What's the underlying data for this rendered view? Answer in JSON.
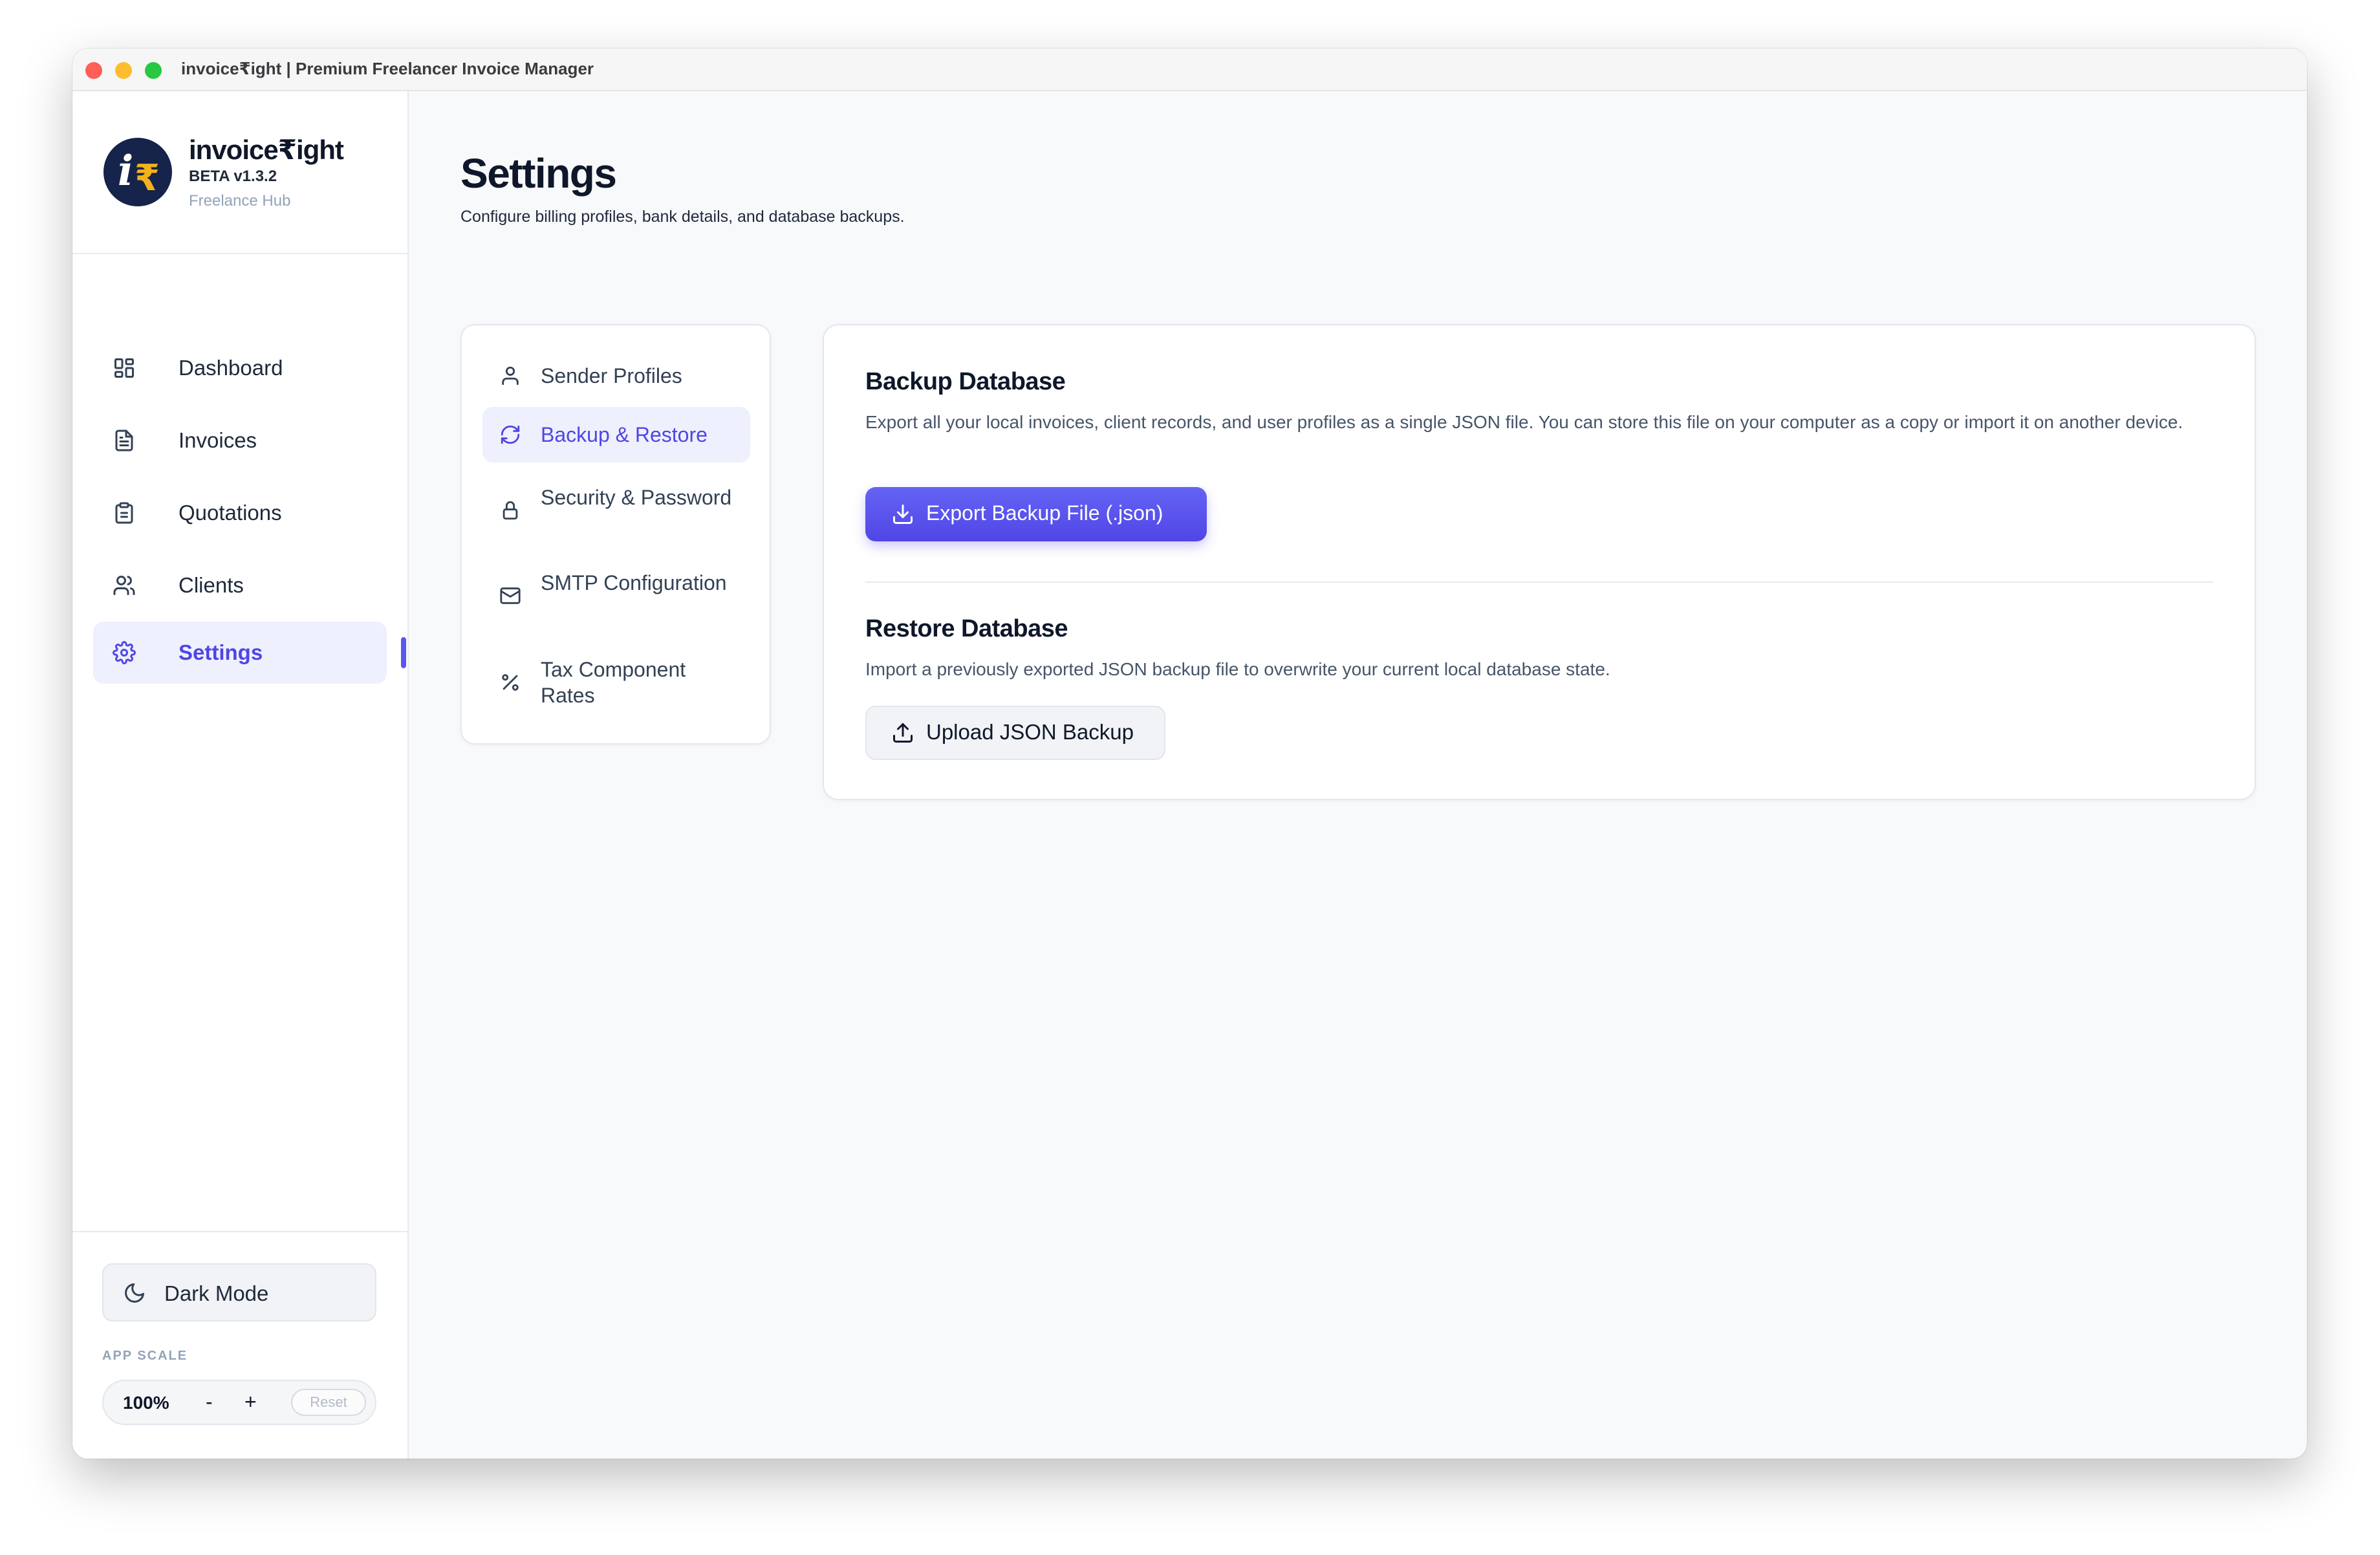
{
  "window": {
    "title": "invoice₹ight | Premium Freelancer Invoice Manager"
  },
  "brand": {
    "name": "invoice₹ight",
    "version": "BETA v1.3.2",
    "tagline": "Freelance Hub",
    "logo_letters": {
      "i": "i",
      "r": "₹"
    }
  },
  "sidebar": {
    "items": [
      {
        "label": "Dashboard",
        "icon": "dashboard-grid-icon"
      },
      {
        "label": "Invoices",
        "icon": "document-icon"
      },
      {
        "label": "Quotations",
        "icon": "clipboard-icon"
      },
      {
        "label": "Clients",
        "icon": "users-icon"
      },
      {
        "label": "Settings",
        "icon": "gear-icon",
        "active": true
      }
    ],
    "dark_mode_label": "Dark Mode",
    "app_scale": {
      "label": "APP SCALE",
      "value": "100%",
      "minus": "-",
      "plus": "+",
      "reset": "Reset"
    }
  },
  "page": {
    "title": "Settings",
    "subtitle": "Configure billing profiles, bank details, and database backups."
  },
  "settings_nav": {
    "items": [
      {
        "label": "Sender Profiles",
        "icon": "user-icon"
      },
      {
        "label": "Backup & Restore",
        "icon": "refresh-icon",
        "active": true
      },
      {
        "label": "Security & Password",
        "icon": "lock-icon"
      },
      {
        "label": "SMTP Configuration",
        "icon": "mail-icon"
      },
      {
        "label": "Tax Component Rates",
        "icon": "percent-icon"
      }
    ]
  },
  "backup": {
    "title": "Backup Database",
    "description": "Export all your local invoices, client records, and user profiles as a single JSON file. You can store this file on your computer as a copy or import it on another device.",
    "button_label": "Export Backup File (.json)"
  },
  "restore": {
    "title": "Restore Database",
    "description": "Import a previously exported JSON backup file to overwrite your current local database state.",
    "button_label": "Upload JSON Backup"
  },
  "colors": {
    "accent": "#5b55f0",
    "active_bg": "#eef0fd",
    "logo_bg": "#16234a",
    "logo_gold": "#f2b21b"
  }
}
